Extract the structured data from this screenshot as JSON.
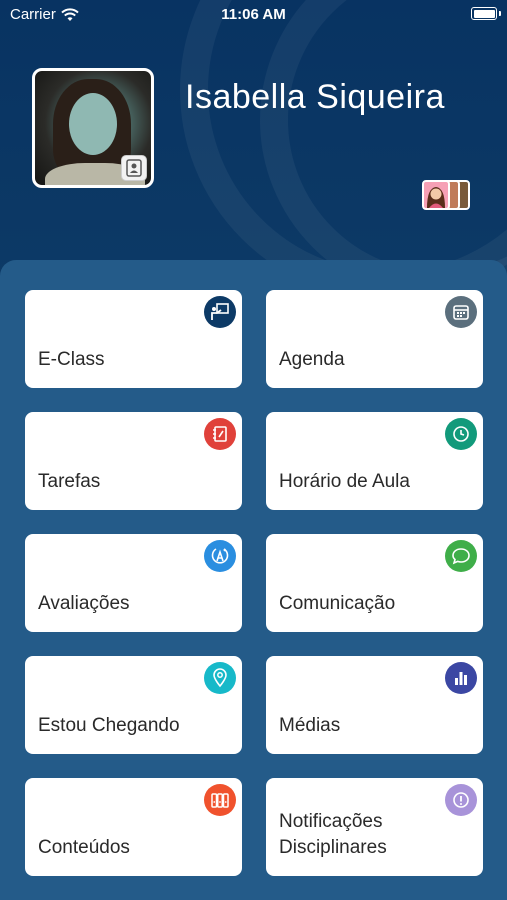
{
  "status_bar": {
    "carrier": "Carrier",
    "time": "11:06 AM"
  },
  "profile": {
    "name": "Isabella Siqueira"
  },
  "tiles": [
    {
      "label": "E-Class",
      "icon": "presentation-icon",
      "color": "#0d3a66"
    },
    {
      "label": "Agenda",
      "icon": "calendar-icon",
      "color": "#5b6f7d"
    },
    {
      "label": "Tarefas",
      "icon": "notebook-icon",
      "color": "#e0413a"
    },
    {
      "label": "Horário de Aula",
      "icon": "clock-icon",
      "color": "#129a7b"
    },
    {
      "label": "Avaliações",
      "icon": "grade-icon",
      "color": "#2a8ee0"
    },
    {
      "label": "Comunicação",
      "icon": "chat-icon",
      "color": "#3fae49"
    },
    {
      "label": "Estou Chegando",
      "icon": "location-pin-icon",
      "color": "#17b9c9"
    },
    {
      "label": "Médias",
      "icon": "bar-chart-icon",
      "color": "#3b47a3"
    },
    {
      "label": "Conteúdos",
      "icon": "binders-icon",
      "color": "#f0522d"
    },
    {
      "label": "Notificações Disciplinares",
      "icon": "alert-icon",
      "color": "#a893d9"
    }
  ]
}
